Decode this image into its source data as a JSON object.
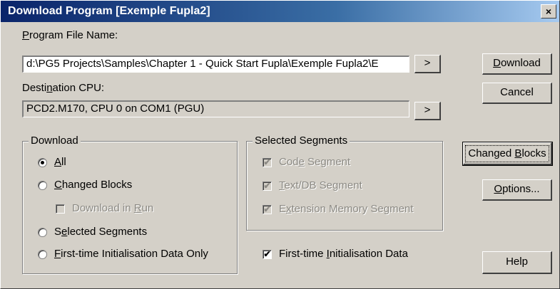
{
  "window": {
    "title": "Download Program [Exemple Fupla2]",
    "close_glyph": "×"
  },
  "program_file": {
    "label_pre": "",
    "label_ul": "P",
    "label_post": "rogram File Name:",
    "value": "d:\\PG5 Projects\\Samples\\Chapter 1 - Quick Start Fupla\\Exemple Fupla2\\E",
    "browse_label": ">"
  },
  "destination": {
    "label_pre": "Desti",
    "label_ul": "n",
    "label_post": "ation CPU:",
    "value": "PCD2.M170, CPU 0 on COM1 (PGU)",
    "browse_label": ">"
  },
  "download_group": {
    "title": "Download",
    "all": {
      "pre": "",
      "ul": "A",
      "post": "ll",
      "checked": true
    },
    "changed_blocks": {
      "pre": "",
      "ul": "C",
      "post": "hanged Blocks",
      "checked": false
    },
    "download_in_run": {
      "pre": "Download in ",
      "ul": "R",
      "post": "un",
      "checked": false
    },
    "selected_segments": {
      "pre": "S",
      "ul": "e",
      "post": "lected Segments",
      "checked": false
    },
    "first_time": {
      "pre": "",
      "ul": "F",
      "post": "irst-time Initialisation Data Only",
      "checked": false
    }
  },
  "segments_group": {
    "title": "Selected Segments",
    "code": {
      "pre": "Cod",
      "ul": "e",
      "post": " Segment",
      "checked": true
    },
    "text_db": {
      "pre": "",
      "ul": "T",
      "post": "ext/DB Segment",
      "checked": true
    },
    "extension": {
      "pre": "E",
      "ul": "x",
      "post": "tension Memory Segment",
      "checked": true
    }
  },
  "first_time_data": {
    "pre": "First-time ",
    "ul": "I",
    "post": "nitialisation Data",
    "checked": true
  },
  "buttons": {
    "download": {
      "pre": "",
      "ul": "D",
      "post": "ownload"
    },
    "cancel": {
      "label": "Cancel"
    },
    "changed_blocks": {
      "pre": "Changed ",
      "ul": "B",
      "post": "locks"
    },
    "options": {
      "pre": "",
      "ul": "O",
      "post": "ptions..."
    },
    "help": {
      "label": "Help"
    }
  },
  "colors": {
    "face": "#d4d0c8",
    "title_start": "#0a246a",
    "title_end": "#a6caf0",
    "disabled_text": "#8c8a84"
  },
  "icons": {
    "radio_dot": "radio-dot",
    "check_mark": "✔"
  }
}
